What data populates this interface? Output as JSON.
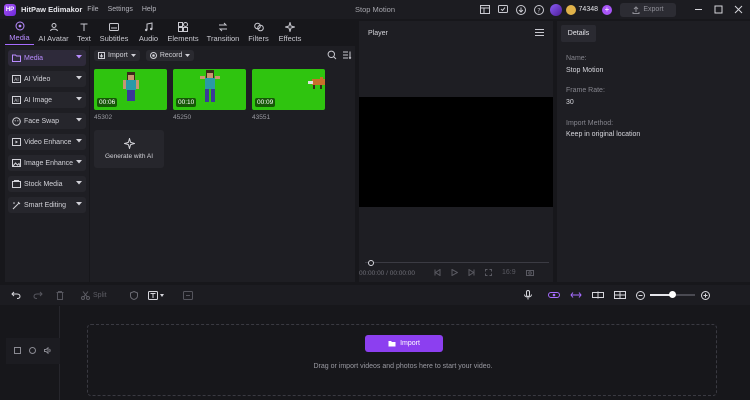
{
  "titlebar": {
    "app_name": "HitPaw Edimakor",
    "menu": [
      "File",
      "Settings",
      "Help"
    ],
    "document_title": "Stop Motion",
    "credits": "74348",
    "export_label": "Export"
  },
  "top_tabs": [
    {
      "label": "Media",
      "icon": "media-icon",
      "active": true
    },
    {
      "label": "AI Avatar",
      "icon": "ai-avatar-icon"
    },
    {
      "label": "Text",
      "icon": "text-icon"
    },
    {
      "label": "Subtitles",
      "icon": "subtitles-icon"
    },
    {
      "label": "Audio",
      "icon": "audio-icon"
    },
    {
      "label": "Elements",
      "icon": "elements-icon"
    },
    {
      "label": "Transition",
      "icon": "transition-icon"
    },
    {
      "label": "Filters",
      "icon": "filters-icon"
    },
    {
      "label": "Effects",
      "icon": "effects-icon"
    }
  ],
  "sidebar": {
    "items": [
      {
        "label": "Media",
        "icon": "folder-icon",
        "active": true
      },
      {
        "label": "AI Video",
        "icon": "ai-video-icon"
      },
      {
        "label": "AI Image",
        "icon": "ai-image-icon"
      },
      {
        "label": "Face Swap",
        "icon": "face-swap-icon"
      },
      {
        "label": "Video Enhance",
        "icon": "video-enhance-icon"
      },
      {
        "label": "Image Enhance",
        "icon": "image-enhance-icon"
      },
      {
        "label": "Stock Media",
        "icon": "stock-media-icon"
      },
      {
        "label": "Smart Editing",
        "icon": "smart-editing-icon"
      }
    ]
  },
  "media": {
    "import_label": "Import",
    "record_label": "Record",
    "clips": [
      {
        "name": "45302",
        "duration": "00:06"
      },
      {
        "name": "45250",
        "duration": "00:10"
      },
      {
        "name": "43551",
        "duration": "00:09"
      }
    ],
    "generate_label": "Generate with AI"
  },
  "player": {
    "title": "Player",
    "time": "00:00:00 / 00:00:00",
    "aspect": "16:9"
  },
  "details": {
    "tab": "Details",
    "name_label": "Name:",
    "name_value": "Stop Motion",
    "frame_rate_label": "Frame Rate:",
    "frame_rate_value": "30",
    "import_method_label": "Import Method:",
    "import_method_value": "Keep in original location"
  },
  "timeline": {
    "split_label": "Split",
    "zoom_level": 0.5,
    "import_label": "Import",
    "hint": "Drag or import videos and photos here to start your video."
  },
  "colors": {
    "accent": "#8c3ff0",
    "thumb_green": "#2fc40f",
    "panel": "#1e1e23"
  }
}
